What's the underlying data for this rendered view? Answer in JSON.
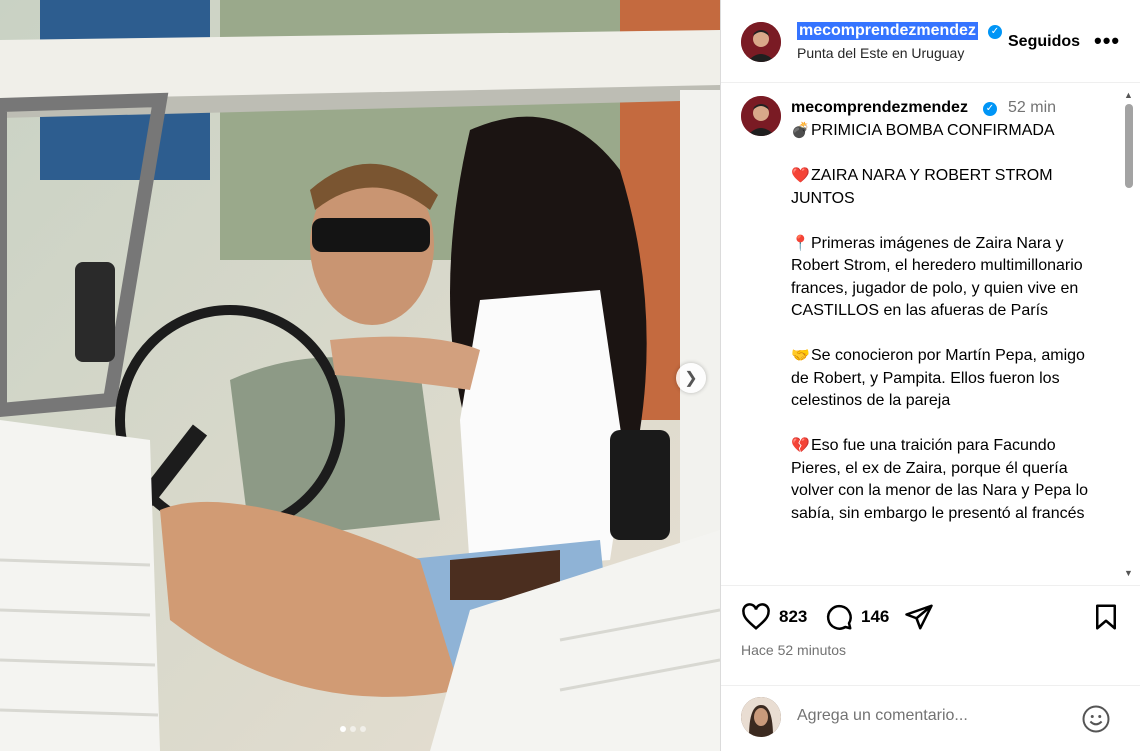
{
  "header": {
    "username": "mecomprendezmendez",
    "location": "Punta del Este en Uruguay",
    "follow_label": "Seguidos",
    "more_label": "•••"
  },
  "caption": {
    "username": "mecomprendezmendez",
    "time": "52 min",
    "paragraphs": [
      {
        "emoji": "💣",
        "text": "PRIMICIA BOMBA CONFIRMADA"
      },
      {
        "emoji": "❤️",
        "text": "ZAIRA NARA Y ROBERT STROM JUNTOS"
      },
      {
        "emoji": "📍",
        "text": "Primeras imágenes de Zaira Nara y Robert Strom, el heredero multimillonario frances, jugador de polo, y quien vive en CASTILLOS en las afueras de París"
      },
      {
        "emoji": "🤝",
        "text": "Se conocieron por Martín Pepa, amigo de Robert, y Pampita. Ellos fueron los celestinos de la pareja"
      },
      {
        "emoji": "💔",
        "text": "Eso fue una traición para Facundo Pieres, el ex de Zaira, porque él quería volver con la menor de las Nara y Pepa lo sabía, sin embargo le presentó al francés"
      }
    ]
  },
  "actions": {
    "likes": "823",
    "comments": "146",
    "icons": [
      "heart-icon",
      "comment-icon",
      "share-icon",
      "bookmark-icon"
    ]
  },
  "posted_ago": "Hace 52 minutos",
  "comment_box": {
    "placeholder": "Agrega un comentario..."
  },
  "colors": {
    "verified": "#0095f6",
    "selection": "#3574ff",
    "secondary_text": "#737373"
  }
}
